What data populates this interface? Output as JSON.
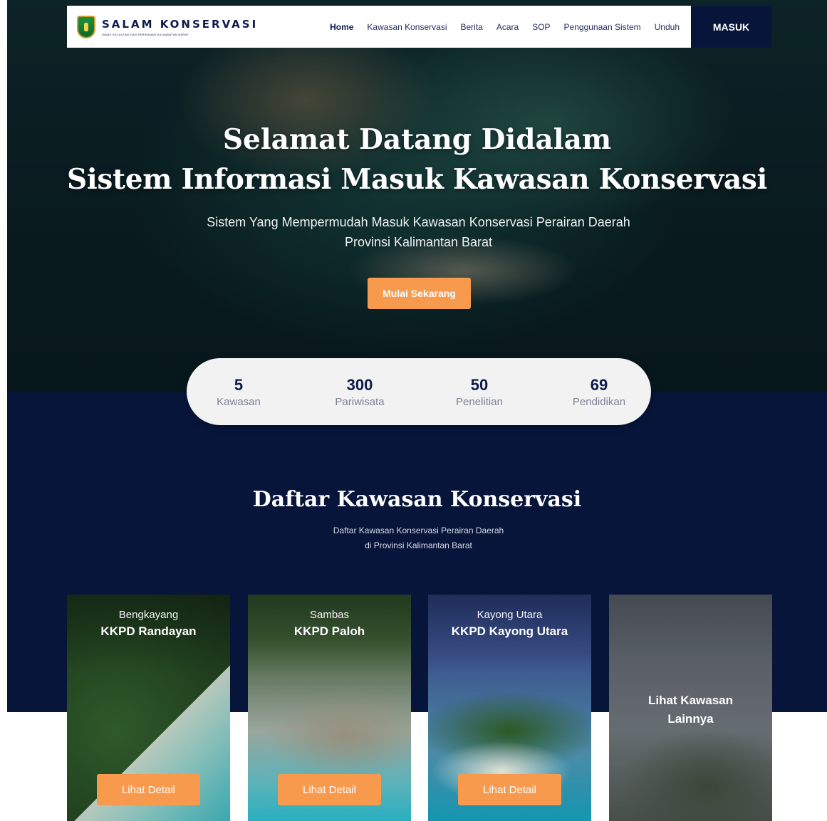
{
  "brand": {
    "title": "SALAM KONSERVASI",
    "subtitle": "Dinas Kelautan dan Perikanan Kalimantan Barat"
  },
  "nav": {
    "items": [
      {
        "label": "Home"
      },
      {
        "label": "Kawasan Konservasi"
      },
      {
        "label": "Berita"
      },
      {
        "label": "Acara"
      },
      {
        "label": "SOP"
      },
      {
        "label": "Penggunaan Sistem"
      },
      {
        "label": "Unduh"
      }
    ],
    "login_label": "MASUK"
  },
  "hero": {
    "title_line1": "Selamat Datang Didalam",
    "title_line2": "Sistem Informasi Masuk Kawasan Konservasi",
    "subtitle_line1": "Sistem Yang Mempermudah Masuk Kawasan Konservasi Perairan Daerah",
    "subtitle_line2": "Provinsi Kalimantan Barat",
    "cta_label": "Mulai Sekarang"
  },
  "stats": [
    {
      "value": "5",
      "label": "Kawasan"
    },
    {
      "value": "300",
      "label": "Pariwisata"
    },
    {
      "value": "50",
      "label": "Penelitian"
    },
    {
      "value": "69",
      "label": "Pendidikan"
    }
  ],
  "section": {
    "title": "Daftar Kawasan Konservasi",
    "subtitle_line1": "Daftar Kawasan Konservasi Perairan Daerah",
    "subtitle_line2": "di Provinsi Kalimantan Barat"
  },
  "cards": [
    {
      "region": "Bengkayang",
      "name": "KKPD Randayan",
      "button": "Lihat Detail"
    },
    {
      "region": "Sambas",
      "name": "KKPD Paloh",
      "button": "Lihat Detail"
    },
    {
      "region": "Kayong Utara",
      "name": "KKPD Kayong Utara",
      "button": "Lihat Detail"
    }
  ],
  "more_card": {
    "line1": "Lihat Kawasan",
    "line2": "Lainnya"
  },
  "colors": {
    "navy": "#07153a",
    "accent_orange": "#f79a4d",
    "stats_bg": "#f2f2f2"
  }
}
